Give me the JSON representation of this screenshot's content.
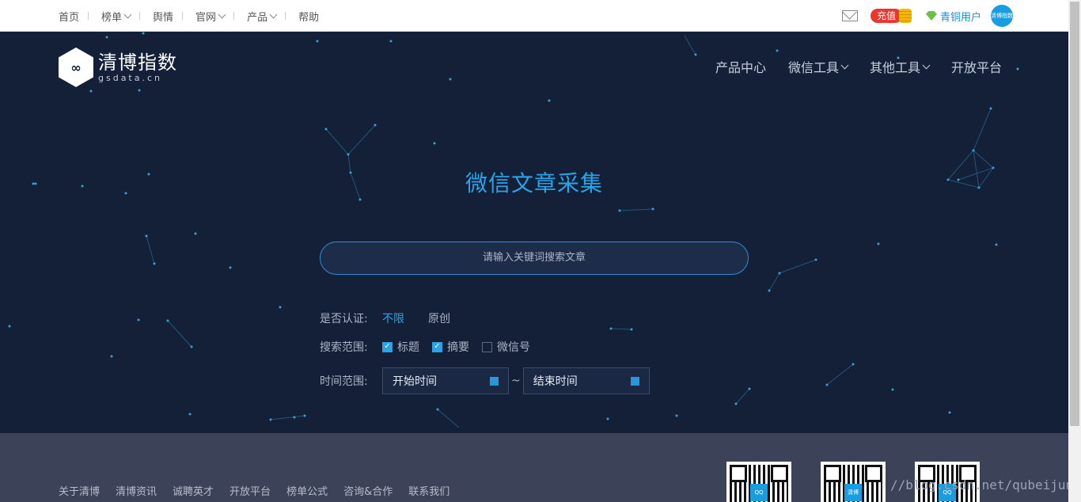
{
  "topbar": {
    "nav": [
      {
        "label": "首页",
        "dropdown": false
      },
      {
        "label": "榜单",
        "dropdown": true
      },
      {
        "label": "舆情",
        "dropdown": false
      },
      {
        "label": "官网",
        "dropdown": true
      },
      {
        "label": "产品",
        "dropdown": true
      },
      {
        "label": "帮助",
        "dropdown": false
      }
    ],
    "recharge_label": "充值",
    "user_name": "青铜用户",
    "avatar_text": "清博指数"
  },
  "header": {
    "logo_cn": "清博指数",
    "logo_en": "gsdata.cn",
    "logo_mark": "∞",
    "nav": [
      {
        "label": "产品中心",
        "dropdown": false
      },
      {
        "label": "微信工具",
        "dropdown": true
      },
      {
        "label": "其他工具",
        "dropdown": true
      },
      {
        "label": "开放平台",
        "dropdown": false
      }
    ]
  },
  "hero": {
    "title": "微信文章采集",
    "search_placeholder": "请输入关键词搜索文章",
    "filters": {
      "cert_label": "是否认证:",
      "cert_options": [
        {
          "label": "不限",
          "active": true
        },
        {
          "label": "原创",
          "active": false
        }
      ],
      "scope_label": "搜索范围:",
      "scope_options": [
        {
          "label": "标题",
          "checked": true
        },
        {
          "label": "摘要",
          "checked": true
        },
        {
          "label": "微信号",
          "checked": false
        }
      ],
      "time_label": "时间范围:",
      "start_time": "开始时间",
      "end_time": "结束时间",
      "separator": "~"
    }
  },
  "footer": {
    "links": [
      "关于清博",
      "清博资讯",
      "诚聘英才",
      "开放平台",
      "榜单公式",
      "咨询&合作",
      "联系我们"
    ],
    "qr_labels": [
      "QQ",
      "清博",
      "QQ"
    ],
    "watermark": "//blog.csdn.net/qubeijun"
  },
  "colors": {
    "hero_bg": "#142038",
    "accent": "#28a4e8",
    "footer_bg": "#3c4258",
    "recharge": "#e8382f"
  }
}
